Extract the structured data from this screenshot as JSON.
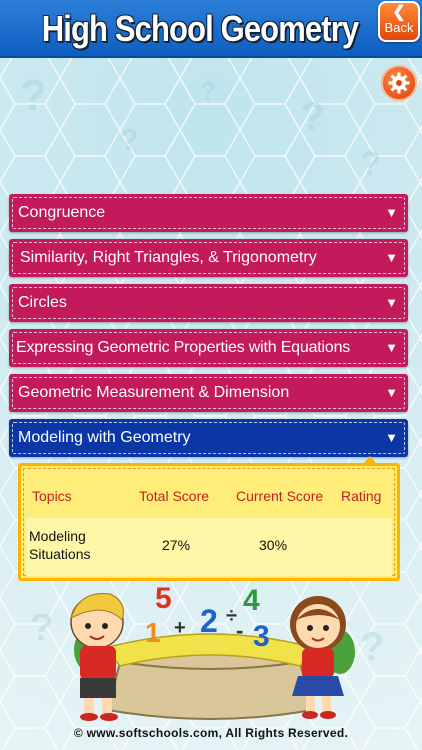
{
  "header": {
    "title": "High School Geometry",
    "back_label": "Back",
    "back_icon": "chevron-left-icon"
  },
  "settings_icon": "gear-icon",
  "menu": {
    "items": [
      {
        "label": "Congruence",
        "arrow": "▼",
        "active": false
      },
      {
        "label": "Similarity, Right Triangles, & Trigonometry",
        "arrow": "▼",
        "active": false
      },
      {
        "label": "Circles",
        "arrow": "▼",
        "active": false
      },
      {
        "label": "Expressing Geometric Properties with Equations",
        "arrow": "▼",
        "active": false
      },
      {
        "label": "Geometric Measurement & Dimension",
        "arrow": "▼",
        "active": false
      },
      {
        "label": "Modeling with Geometry",
        "arrow": "▼",
        "active": true
      }
    ]
  },
  "scores": {
    "headers": {
      "topics": "Topics",
      "total": "Total Score",
      "current": "Current Score",
      "rating": "Rating"
    },
    "rows": [
      {
        "topic_line1": "Modeling",
        "topic_line2": "Situations",
        "total": "27%",
        "current": "30%",
        "rating": ""
      }
    ]
  },
  "illustration": {
    "digits": [
      "5",
      "4",
      "2",
      "3",
      "1"
    ],
    "symbols": [
      "+",
      "÷",
      "-"
    ]
  },
  "footer": {
    "text": "© www.softschools.com, All Rights Reserved."
  },
  "colors": {
    "header_blue": "#0e5ec0",
    "item_magenta": "#c21a5a",
    "item_active_blue": "#0b36a6",
    "panel_yellow": "#ffed7a",
    "button_orange": "#e2480a"
  }
}
